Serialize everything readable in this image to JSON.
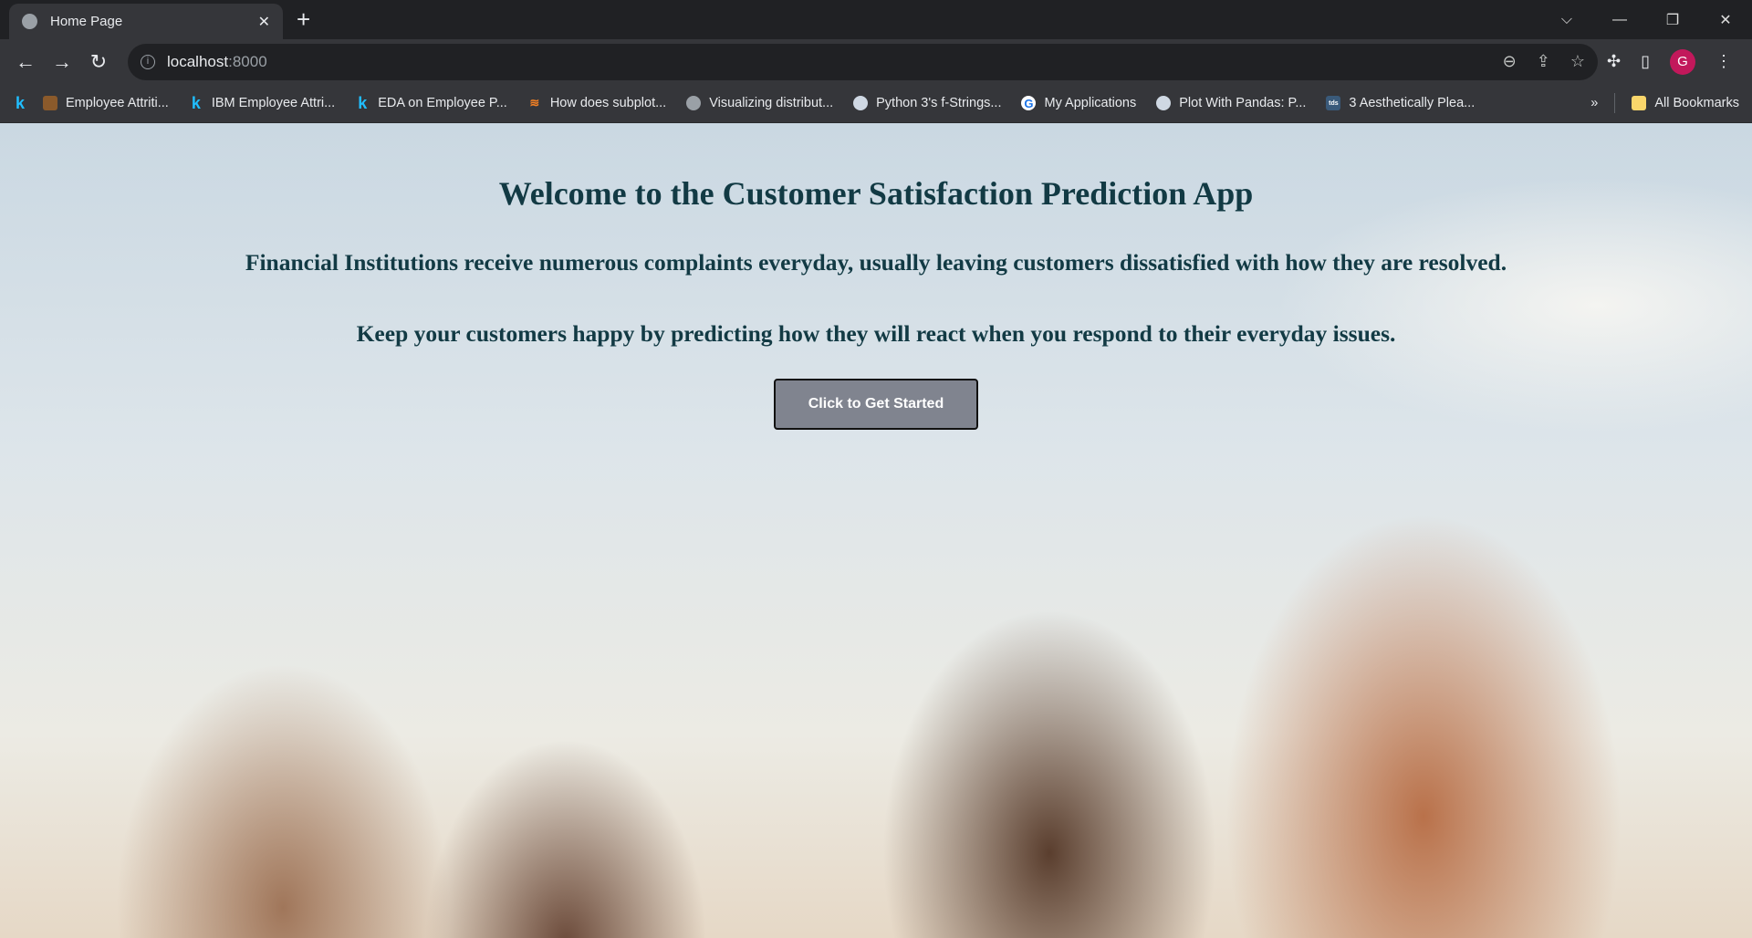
{
  "browser": {
    "tab_title": "Home Page",
    "url_host": "localhost",
    "url_port": ":8000",
    "profile_initial": "G",
    "bookmarks": [
      {
        "label": "Employee Attriti...",
        "icon": "kaggle-icon"
      },
      {
        "label": "IBM Employee Attri...",
        "icon": "kaggle-icon"
      },
      {
        "label": "EDA on Employee P...",
        "icon": "kaggle-icon"
      },
      {
        "label": "How does subplot...",
        "icon": "stackoverflow-icon"
      },
      {
        "label": "Visualizing distribut...",
        "icon": "globe-icon"
      },
      {
        "label": "Python 3's f-Strings...",
        "icon": "python-icon"
      },
      {
        "label": "My Applications",
        "icon": "google-icon"
      },
      {
        "label": "Plot With Pandas: P...",
        "icon": "python-icon"
      },
      {
        "label": "3 Aesthetically Plea...",
        "icon": "tds-icon"
      }
    ],
    "overflow_label": "»",
    "all_bookmarks": "All Bookmarks"
  },
  "page": {
    "title": "Welcome to the Customer Satisfaction Prediction App",
    "subtitle1": "Financial Institutions receive numerous complaints everyday, usually leaving customers dissatisfied with how they are resolved.",
    "subtitle2": "Keep your customers happy by predicting how they will react when you respond to their everyday issues.",
    "cta_label": "Click to Get Started"
  }
}
